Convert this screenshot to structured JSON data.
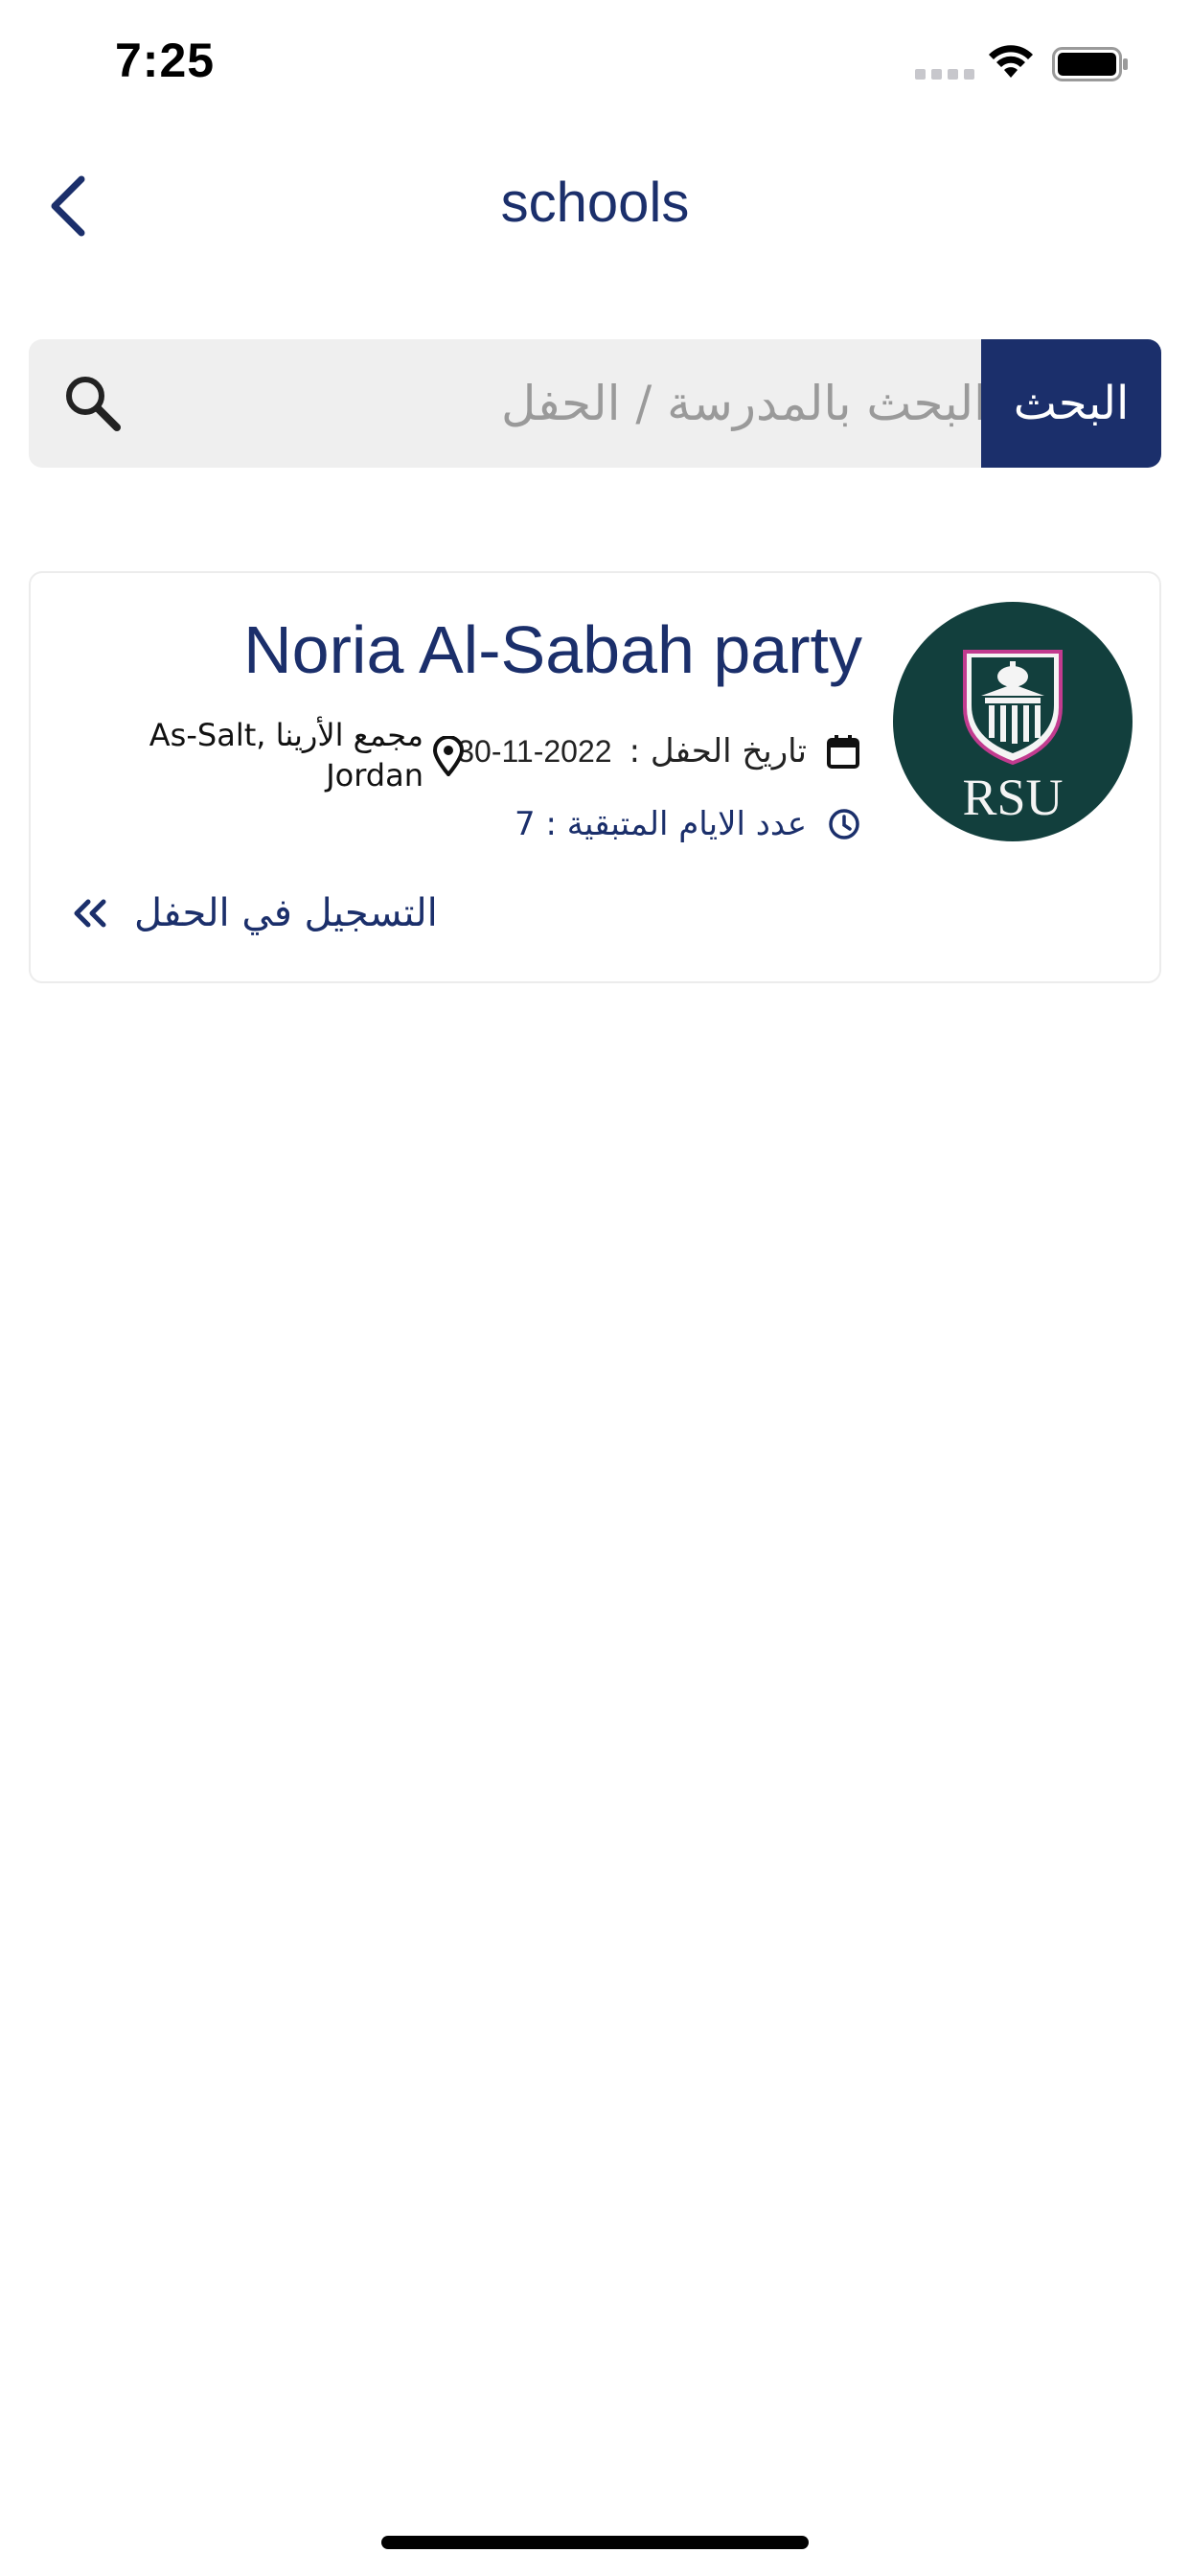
{
  "status_bar": {
    "time": "7:25"
  },
  "nav": {
    "title": "schools"
  },
  "search": {
    "placeholder": "البحث بالمدرسة / الحفل",
    "button_label": "البحث"
  },
  "card": {
    "logo_text": "RSU",
    "title": "Noria Al-Sabah party",
    "date_label": "تاريخ الحفل :",
    "date_value": "30-11-2022",
    "location_line1": "As-Salt, مجمع الأرينا",
    "location_line2": "Jordan",
    "days_remaining": "عدد الايام المتبقية : 7",
    "register_label": "التسجيل في الحفل"
  },
  "colors": {
    "brand": "#1b2f6b",
    "logo_bg": "#123f3d",
    "search_bg": "#efefef"
  },
  "icons": [
    "back-chevron-icon",
    "search-icon",
    "calendar-icon",
    "location-pin-icon",
    "clock-icon",
    "double-chevron-left-icon",
    "wifi-icon",
    "battery-icon"
  ]
}
